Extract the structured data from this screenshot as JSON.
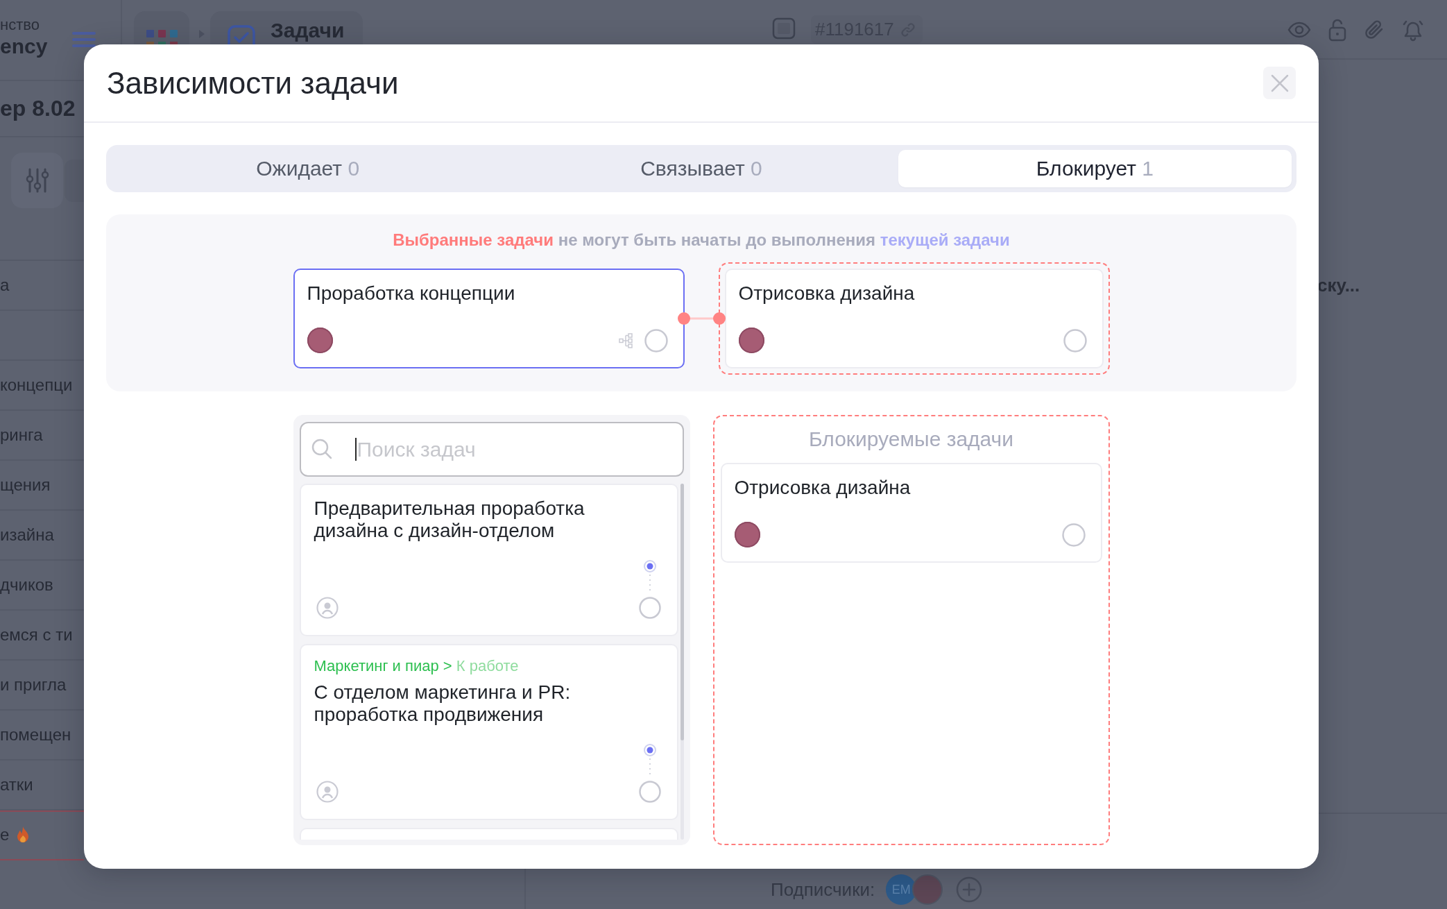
{
  "app": {
    "brand": {
      "subtitle": "нство",
      "name": "ency"
    },
    "top_bar": {
      "section_tab": "Задачи",
      "task_number": "#1191617"
    },
    "project_title": "ер 8.02",
    "task_rows": [
      {
        "title": "а",
        "urgent": false
      },
      {
        "title": "концепци",
        "urgent": false
      },
      {
        "title": "ринга",
        "urgent": false
      },
      {
        "title": "щения",
        "urgent": false
      },
      {
        "title": "изайна",
        "urgent": false
      },
      {
        "title": "дчиков",
        "urgent": false
      },
      {
        "title": "емся с ти",
        "urgent": false
      },
      {
        "title": "и пригла",
        "urgent": false
      },
      {
        "title": "помещен",
        "urgent": false
      },
      {
        "title": "атки",
        "urgent": false
      },
      {
        "title": "е",
        "urgent": true
      }
    ],
    "detail_text": "ску...",
    "subscribers": {
      "label": "Подписчики:",
      "people": [
        {
          "kind": "initials",
          "initials": "EM"
        },
        {
          "kind": "photo"
        }
      ]
    }
  },
  "modal": {
    "title": "Зависимости задачи",
    "tabs": [
      {
        "label": "Ожидает",
        "count": "0",
        "selected": false
      },
      {
        "label": "Связывает",
        "count": "0",
        "selected": false
      },
      {
        "label": "Блокирует",
        "count": "1",
        "selected": true
      }
    ],
    "hint": [
      {
        "kind": "selected",
        "text": "Выбранные задачи"
      },
      {
        "kind": "plain",
        "text": "не могут быть начаты до выполнения"
      },
      {
        "kind": "current",
        "text": "текущей задачи"
      }
    ],
    "current_task": {
      "title": "Проработка концепции"
    },
    "linked_task": {
      "title": "Отрисовка дизайна"
    },
    "search": {
      "placeholder": "Поиск задач"
    },
    "candidates": [
      {
        "title": "Предварительная проработка\nдизайна с дизайн-отделом"
      },
      {
        "breadcrumb": {
          "project": "Маркетинг и пиар",
          "separator": ">",
          "stage": "К работе"
        },
        "title": "С отделом маркетинга и PR:\nпроработка продвижения"
      }
    ],
    "blocked": {
      "heading": "Блокируемые задачи",
      "tasks": [
        {
          "title": "Отрисовка дизайна"
        }
      ]
    }
  }
}
